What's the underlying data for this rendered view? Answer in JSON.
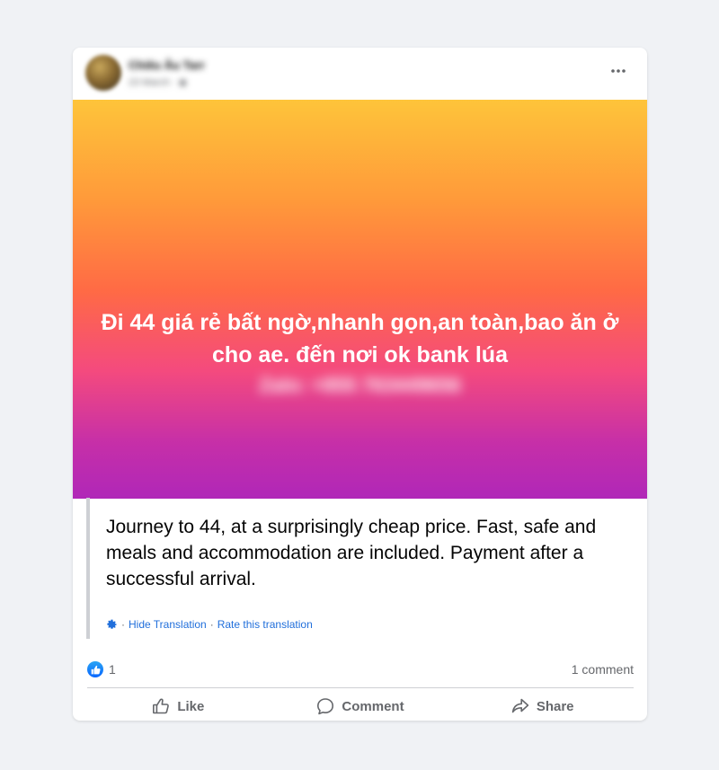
{
  "post": {
    "author": "Chiêu Âu Tarr",
    "timestamp": "23 March",
    "audience_icon": "globe-icon",
    "more_icon": "more-options-icon"
  },
  "hero": {
    "text": "Đi 44 giá rẻ bất ngờ,nhanh gọn,an toàn,bao ăn ở cho ae. đến nơi ok bank lúa",
    "blurred_phone": "Zalo: +855 763449656",
    "gradient": [
      "#fec43a",
      "#ff6a45",
      "#b027b8"
    ]
  },
  "translation": {
    "text": "Journey to 44, at a surprisingly cheap price. Fast, safe and meals and accommodation are included. Payment after a successful arrival.",
    "hide_label": "Hide Translation",
    "separator": "·",
    "rate_label": "Rate this translation",
    "link_color": "#216fdb"
  },
  "stats": {
    "reaction_icon": "like-reaction-icon",
    "reaction_count": "1",
    "comments": "1 comment"
  },
  "actions": {
    "like": "Like",
    "comment": "Comment",
    "share": "Share"
  }
}
